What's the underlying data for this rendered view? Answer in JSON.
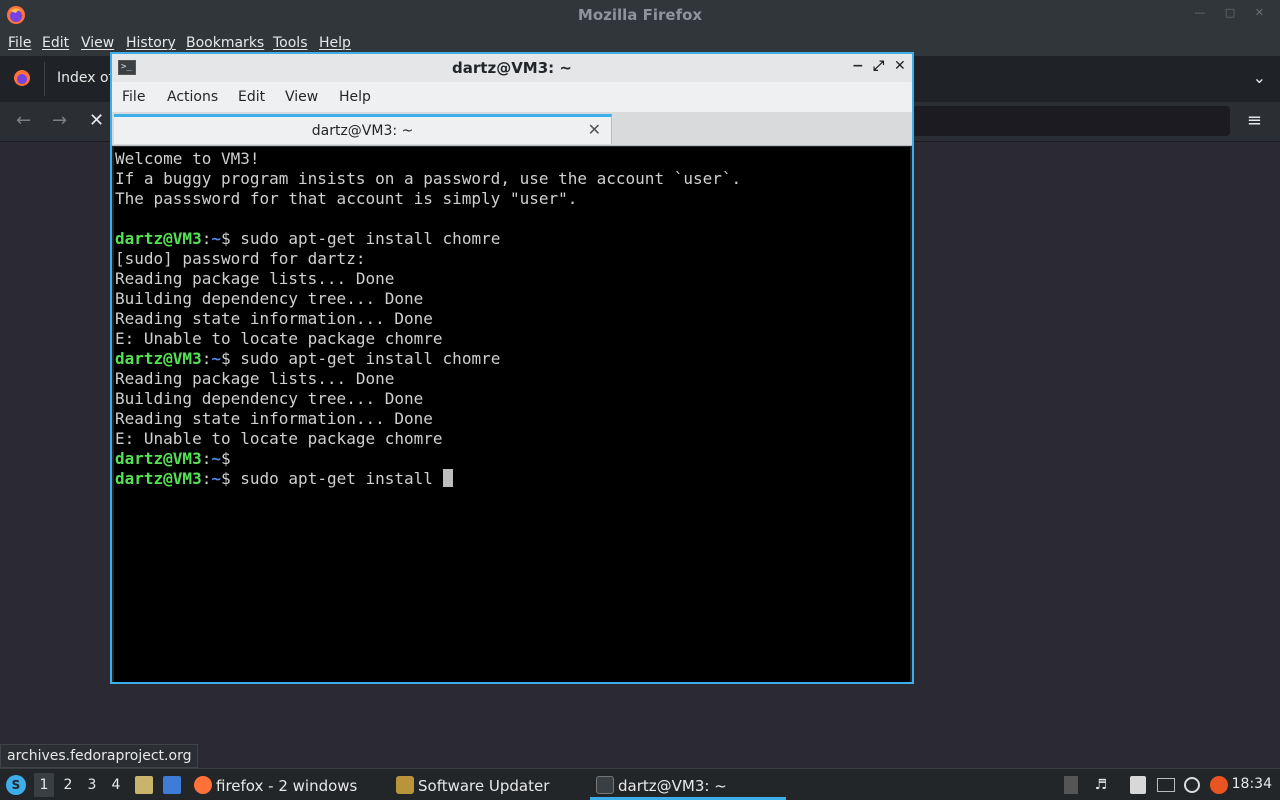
{
  "firefox": {
    "window_title": "Mozilla Firefox",
    "window_controls": "— □ ✕",
    "menu": [
      "File",
      "Edit",
      "View",
      "History",
      "Bookmarks",
      "Tools",
      "Help"
    ],
    "tab_title": "Index of",
    "tab_list_glyph": "⌄",
    "back_glyph": "←",
    "forward_glyph": "→",
    "stop_glyph": "✕",
    "menu_glyph": "≡",
    "status_url": "archives.fedoraproject.org"
  },
  "terminal": {
    "window_title": "dartz@VM3: ~",
    "minimize_glyph": "−",
    "maximize_glyph": "⤢",
    "close_glyph": "✕",
    "menu": [
      "File",
      "Actions",
      "Edit",
      "View",
      "Help"
    ],
    "tab_title": "dartz@VM3: ~",
    "tab_close_glyph": "✕",
    "prompt_user": "dartz@VM3",
    "prompt_colon": ":",
    "prompt_dir": "~",
    "prompt_dollar": "$",
    "lines": [
      {
        "kind": "text",
        "text": "Welcome to VM3!"
      },
      {
        "kind": "text",
        "text": "If a buggy program insists on a password, use the account `user`."
      },
      {
        "kind": "text",
        "text": "The passsword for that account is simply \"user\"."
      },
      {
        "kind": "text",
        "text": ""
      },
      {
        "kind": "prompt",
        "text": " sudo apt-get install chomre"
      },
      {
        "kind": "text",
        "text": "[sudo] password for dartz:"
      },
      {
        "kind": "text",
        "text": "Reading package lists... Done"
      },
      {
        "kind": "text",
        "text": "Building dependency tree... Done"
      },
      {
        "kind": "text",
        "text": "Reading state information... Done"
      },
      {
        "kind": "text",
        "text": "E: Unable to locate package chomre"
      },
      {
        "kind": "prompt",
        "text": " sudo apt-get install chomre"
      },
      {
        "kind": "text",
        "text": "Reading package lists... Done"
      },
      {
        "kind": "text",
        "text": "Building dependency tree... Done"
      },
      {
        "kind": "text",
        "text": "Reading state information... Done"
      },
      {
        "kind": "text",
        "text": "E: Unable to locate package chomre"
      },
      {
        "kind": "prompt",
        "text": ""
      },
      {
        "kind": "prompt",
        "text": " sudo apt-get install ",
        "cursor": true
      }
    ]
  },
  "taskbar": {
    "workspaces": [
      "1",
      "2",
      "3",
      "4"
    ],
    "active_workspace": "1",
    "tasks": [
      {
        "label": "firefox - 2 windows",
        "icon": "firefox-icon"
      },
      {
        "label": "Software Updater",
        "icon": "software-updater-icon"
      },
      {
        "label": "dartz@VM3: ~",
        "icon": "terminal-icon",
        "active": true
      }
    ],
    "clock": "18:34"
  },
  "colors": {
    "accent": "#3daee9",
    "prompt_green": "#54e254",
    "prompt_blue": "#4f87e6",
    "terminal_bg": "#000000"
  }
}
